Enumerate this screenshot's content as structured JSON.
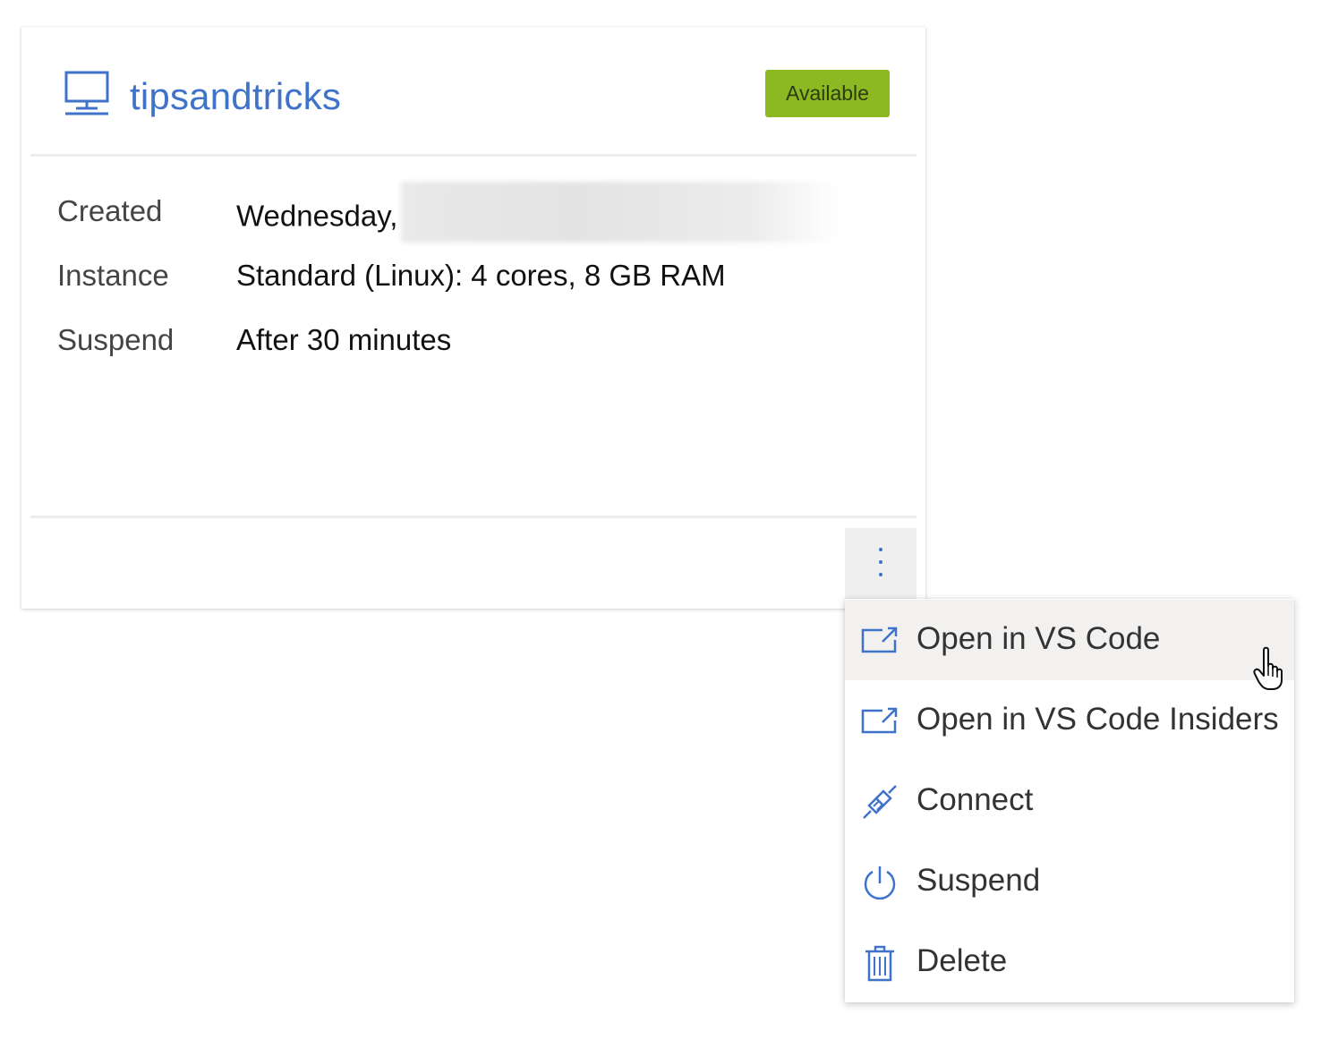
{
  "card": {
    "name": "tipsandtricks",
    "icon": "monitor-icon",
    "status": "Available",
    "status_color": "#8cb922",
    "accent_color": "#3f72c9",
    "details": [
      {
        "label": "Created",
        "value": "Wednesday,"
      },
      {
        "label": "Instance",
        "value": "Standard (Linux): 4 cores, 8 GB RAM"
      },
      {
        "label": "Suspend",
        "value": "After 30 minutes"
      }
    ],
    "more_icon": "more-vertical-icon"
  },
  "menu": {
    "items": [
      {
        "label": "Open in VS Code",
        "icon": "open-external-icon"
      },
      {
        "label": "Open in VS Code Insiders",
        "icon": "open-external-icon"
      },
      {
        "label": "Connect",
        "icon": "plug-icon"
      },
      {
        "label": "Suspend",
        "icon": "power-icon"
      },
      {
        "label": "Delete",
        "icon": "trash-icon"
      }
    ]
  }
}
